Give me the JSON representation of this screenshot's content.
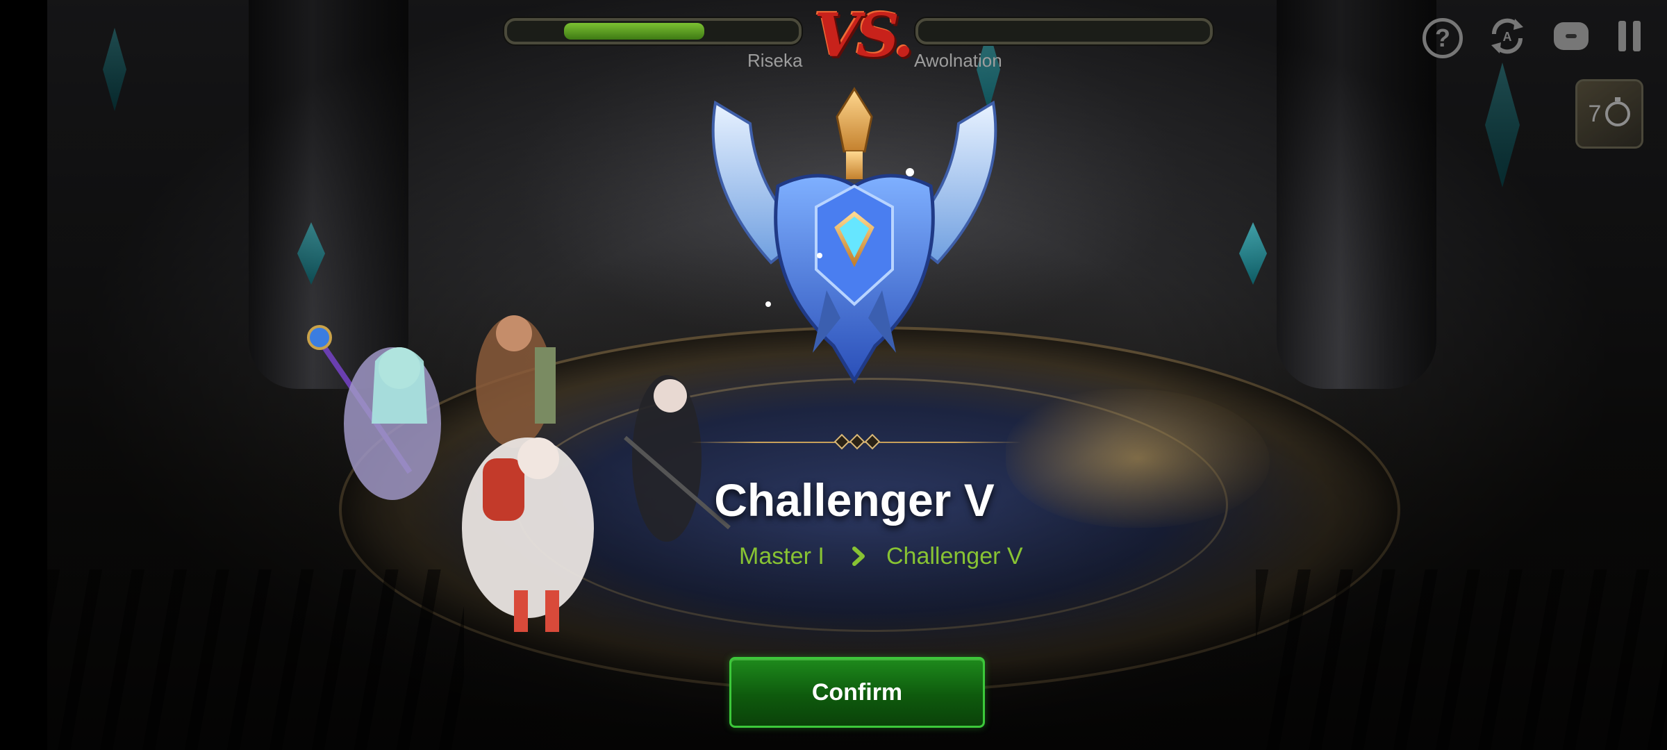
{
  "battle": {
    "vs_label": "VS.",
    "left_player": {
      "name": "Riseka",
      "hp_fraction": 0.68
    },
    "right_player": {
      "name": "Awolnation",
      "hp_fraction": 0.0
    }
  },
  "hud": {
    "help_icon": "question-circle-icon",
    "auto_icon": "auto-cycle-icon",
    "chat_icon": "chat-bubble-icon",
    "pause_icon": "pause-icon",
    "speed_label": "7",
    "speed_icon": "stopwatch-icon"
  },
  "result": {
    "emblem_icon": "challenger-rank-emblem",
    "rank_title": "Challenger V",
    "from_rank": "Master I",
    "to_rank": "Challenger V",
    "arrow_icon": "chevron-right-icon",
    "confirm_label": "Confirm"
  },
  "colors": {
    "accent_green": "#88c333",
    "button_green": "#1e8a1c",
    "vs_red": "#c8221b"
  }
}
